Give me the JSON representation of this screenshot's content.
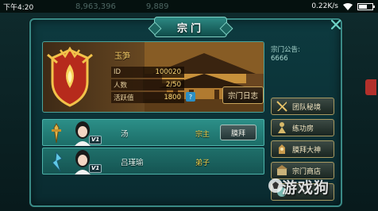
{
  "status_bar": {
    "time": "下午4:20",
    "game_currency_1": "8,963,396",
    "game_currency_2": "9,889",
    "network_speed": "0.22K/s"
  },
  "dialog": {
    "title": "宗门"
  },
  "sect": {
    "name": "玉笋",
    "stats": [
      {
        "label": "ID",
        "value": "100020"
      },
      {
        "label": "人数",
        "value": "2/50"
      },
      {
        "label": "活跃值",
        "value": "1800"
      }
    ],
    "help_label": "?",
    "log_button": "宗门日志"
  },
  "members": [
    {
      "class_icon": "warrior-class-icon",
      "name": "汤",
      "rank": "宗主",
      "vip": "V1",
      "action": "膜拜",
      "selected": true
    },
    {
      "class_icon": "mage-class-icon",
      "name": "吕瑾瑜",
      "rank": "弟子",
      "vip": "V1",
      "selected": false
    }
  ],
  "announcement": {
    "title": "宗门公告:",
    "text": "6666"
  },
  "side_buttons": [
    {
      "label": "团队秘境",
      "icon": "sword-icon"
    },
    {
      "label": "练功房",
      "icon": "training-icon"
    },
    {
      "label": "膜拜大神",
      "icon": "worship-icon"
    },
    {
      "label": "宗门商店",
      "icon": "shop-icon"
    },
    {
      "label": "",
      "icon": "more-icon"
    }
  ],
  "watermark": "游戏狗",
  "colors": {
    "panel_teal": "#1f6f6a",
    "border_teal": "#4db3aa",
    "rank_gold": "#f2d34d",
    "title_text": "#ffffff"
  }
}
